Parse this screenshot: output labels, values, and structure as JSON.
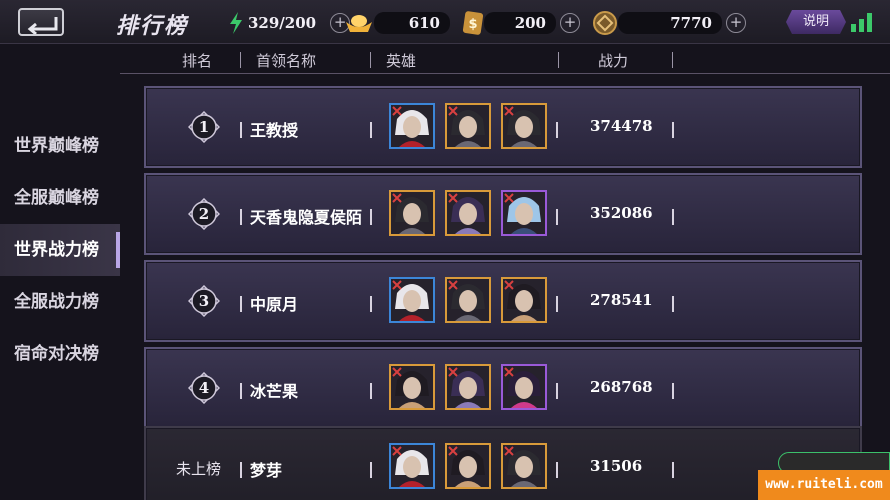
{
  "header_bar": {
    "title": "排行榜",
    "stamina": "329/200",
    "gold": "610",
    "coupons": "200",
    "coins": "7770",
    "help_label": "说明"
  },
  "columns": {
    "rank": "排名",
    "leader": "首领名称",
    "heroes": "英雄",
    "power": "战力"
  },
  "sidebar": {
    "items": [
      {
        "label": "世界巅峰榜"
      },
      {
        "label": "全服巅峰榜"
      },
      {
        "label": "世界战力榜"
      },
      {
        "label": "全服战力榜"
      },
      {
        "label": "宿命对决榜"
      }
    ],
    "active_index": 2
  },
  "rows": [
    {
      "rank": "1",
      "leader": "王教授",
      "power": "374478",
      "heroes": [
        "red-white-hair",
        "dark-armor",
        "dark-armor"
      ]
    },
    {
      "rank": "2",
      "leader": "天香鬼隐夏侯陌",
      "power": "352086",
      "heroes": [
        "dark-armor",
        "shadow-beast",
        "blue-hair"
      ]
    },
    {
      "rank": "3",
      "leader": "中原月",
      "power": "278541",
      "heroes": [
        "red-white-hair",
        "dark-armor",
        "dark-hair"
      ]
    },
    {
      "rank": "4",
      "leader": "冰芒果",
      "power": "268768",
      "heroes": [
        "dark-hair",
        "shadow-beast",
        "masked"
      ]
    },
    {
      "rank": "未上榜",
      "leader": "梦芽",
      "power": "31506",
      "heroes": [
        "red-white-hair",
        "dark-hair",
        "dark-armor"
      ]
    }
  ],
  "watermark": "www.ruiteli.com",
  "colors": {
    "accent": "#b9a6e6",
    "row_border": "#5b5478",
    "frame_gold": "#d89a3a",
    "frame_blue": "#3c86d8",
    "frame_purple": "#9a5ad8",
    "watermark_bg": "#f08a1c"
  }
}
